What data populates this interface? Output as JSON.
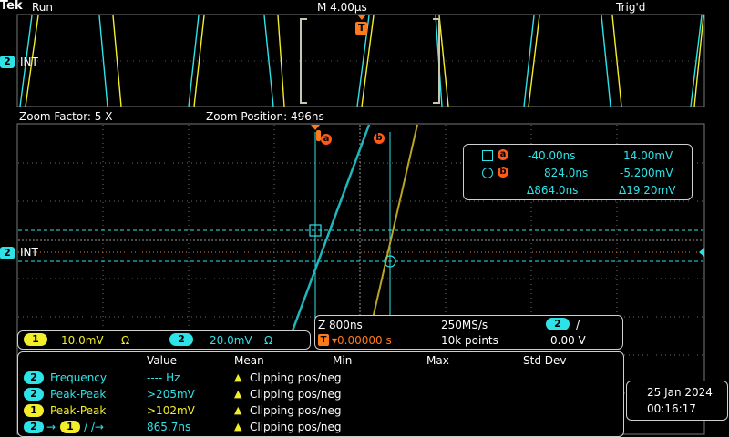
{
  "header": {
    "brand": "Tek",
    "run_state": "Run",
    "timebase": "M 4.00µs",
    "trigger_state": "Trig'd"
  },
  "overview": {
    "channel_marker": "2",
    "channel_label": "INT",
    "trigger_marker": "T"
  },
  "zoom": {
    "factor": "Zoom Factor: 5 X",
    "position": "Zoom Position: 496ns"
  },
  "main": {
    "channel_marker": "2",
    "channel_label": "INT",
    "cursor_a_label": "a",
    "cursor_b_label": "b"
  },
  "cursor_readout": {
    "a_time": "-40.00ns",
    "a_value": "14.00mV",
    "b_time": "824.0ns",
    "b_value": "-5.200mV",
    "delta_time": "Δ864.0ns",
    "delta_value": "Δ19.20mV"
  },
  "channels": {
    "ch1_num": "1",
    "ch1_scale": "10.0mV",
    "ch1_coupling": "Ω",
    "ch2_num": "2",
    "ch2_scale": "20.0mV",
    "ch2_coupling": "Ω"
  },
  "acquisition": {
    "zoom_scale": "Z 800ns",
    "sample_rate": "250MS/s",
    "trigger_source": "2",
    "trigger_slope": "/",
    "trigger_position": "▾0.00000 s",
    "record_length": "10k points",
    "trigger_level": "0.00 V"
  },
  "measurements": {
    "headers": [
      "Value",
      "Mean",
      "Min",
      "Max",
      "Std Dev"
    ],
    "rows": [
      {
        "ch": "2",
        "name": "Frequency",
        "value": "---- Hz",
        "status": "Clipping pos/neg"
      },
      {
        "ch": "2",
        "name": "Peak-Peak",
        "value": ">205mV",
        "status": "Clipping pos/neg"
      },
      {
        "ch": "1",
        "name": "Peak-Peak",
        "value": ">102mV",
        "status": "Clipping pos/neg"
      },
      {
        "ch": "2",
        "name": "→",
        "ch2": "1",
        "edge": "/ /→",
        "value": "865.7ns",
        "status": "Clipping pos/neg"
      }
    ]
  },
  "datetime": {
    "date": "25 Jan  2024",
    "time": "00:16:17"
  },
  "colors": {
    "ch1": "#f3ee2a",
    "ch2": "#2ee3e8",
    "cursor": "#ff7a1a"
  }
}
